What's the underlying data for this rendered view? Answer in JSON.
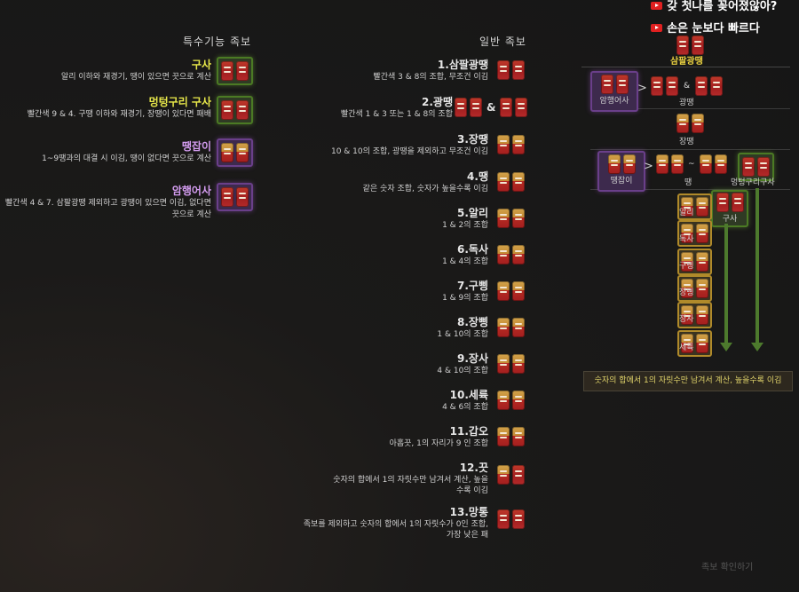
{
  "banners": [
    {
      "text": "갖 첫나를 꽂어졌않아?"
    },
    {
      "text": "손은 눈보다 빠르다"
    }
  ],
  "sections": {
    "special_title": "특수기능 족보",
    "normal_title": "일반 족보"
  },
  "special": [
    {
      "name": "구사",
      "desc": "알리 이하와 재경기, 땡이 있으면 끗으로 계산",
      "color": "#e8e84a"
    },
    {
      "name": "멍텅구리 구사",
      "desc": "빨간색 9 & 4. 구땡 이하와 재경기, 장땡이 있다면 패배",
      "color": "#e8e84a"
    },
    {
      "name": "땡잡이",
      "desc": "1~9땡과의 대결 시 이김, 땡이 없다면 끗으로 계산",
      "color": "#d49cf0"
    },
    {
      "name": "암행어사",
      "desc": "빨간색 4 & 7. 삼팔광땡 제외하고 광땡이 있으면 이김, 없다면 끗으로 계산",
      "color": "#d49cf0"
    }
  ],
  "normal": [
    {
      "name": "1.삼팔광땡",
      "desc": "빨간색 3 & 8의 조합, 무조건 이김"
    },
    {
      "name": "2.광땡",
      "desc": "빨간색 1 & 3 또는 1 & 8의 조합",
      "amp": "&"
    },
    {
      "name": "3.장땡",
      "desc": "10 & 10의 조합, 광땡을 제외하고 무조건 이김"
    },
    {
      "name": "4.땡",
      "desc": "같은 숫자 조합, 숫자가 높을수록 이김"
    },
    {
      "name": "5.알리",
      "desc": "1 & 2의 조합"
    },
    {
      "name": "6.독사",
      "desc": "1 & 4의 조합"
    },
    {
      "name": "7.구삥",
      "desc": "1 & 9의 조합"
    },
    {
      "name": "8.장삥",
      "desc": "1 & 10의 조합"
    },
    {
      "name": "9.장사",
      "desc": "4 & 10의 조합"
    },
    {
      "name": "10.세륙",
      "desc": "4 & 6의 조합"
    },
    {
      "name": "11.갑오",
      "desc": "아홉끗, 1의 자리가 9 인 조합"
    },
    {
      "name": "12.끗",
      "desc": "숫자의 합에서 1의 자릿수만 남겨서 계산, 높을수록 이김"
    },
    {
      "name": "13.망통",
      "desc": "족보를 제외하고 숫자의 합에서 1의 자릿수가 0인 조합, 가장 낮은 패"
    }
  ],
  "diagram": {
    "top_label": "삼팔광땡",
    "amhaeng_label": "암행어사",
    "gwangttaeng_label": "광땡",
    "amp": "&",
    "jangttaeng_label": "장땡",
    "ttaengjapi_label": "땡잡이",
    "ttaeng_label": "땡",
    "tilde": "~",
    "meongteong_label": "멍텅구리구사",
    "gusa_label": "구사",
    "chain": [
      "알리",
      "독사",
      "구삥",
      "장삥",
      "장사",
      "세륙"
    ],
    "note": "숫자의 합에서 1의 자릿수만 남겨서 계산, 높을수록 이김",
    "gt": ">"
  },
  "watermark": "족보 확인하기"
}
